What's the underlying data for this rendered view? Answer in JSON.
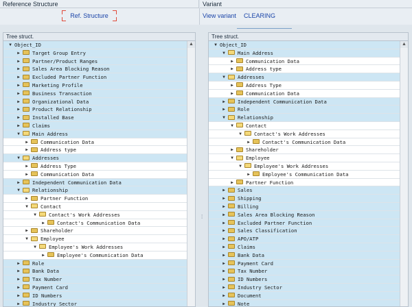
{
  "left_panel": {
    "title": "Reference Structure",
    "ref_button": "Ref. Structure",
    "tree_header": "Tree struct.",
    "rows": [
      {
        "label": "Object_ID",
        "depth": 0,
        "toggle": "open",
        "folder": false,
        "selected": true
      },
      {
        "label": "Target Group Entry",
        "depth": 1,
        "toggle": "closed",
        "folder": true,
        "selected": true
      },
      {
        "label": "Partner/Product Ranges",
        "depth": 1,
        "toggle": "closed",
        "folder": true,
        "selected": true
      },
      {
        "label": "Sales Area Blocking Reason",
        "depth": 1,
        "toggle": "closed",
        "folder": true,
        "selected": true
      },
      {
        "label": "Excluded Partner Function",
        "depth": 1,
        "toggle": "closed",
        "folder": true,
        "selected": true
      },
      {
        "label": "Marketing Profile",
        "depth": 1,
        "toggle": "closed",
        "folder": true,
        "selected": true
      },
      {
        "label": "Business Transaction",
        "depth": 1,
        "toggle": "closed",
        "folder": true,
        "selected": true
      },
      {
        "label": "Organizational Data",
        "depth": 1,
        "toggle": "closed",
        "folder": true,
        "selected": true
      },
      {
        "label": "Product Relationship",
        "depth": 1,
        "toggle": "closed",
        "folder": true,
        "selected": true
      },
      {
        "label": "Installed Base",
        "depth": 1,
        "toggle": "closed",
        "folder": true,
        "selected": true
      },
      {
        "label": "Claims",
        "depth": 1,
        "toggle": "closed",
        "folder": true,
        "selected": true
      },
      {
        "label": "Main Address",
        "depth": 1,
        "toggle": "open",
        "folder": true,
        "selected": true
      },
      {
        "label": "Communication Data",
        "depth": 2,
        "toggle": "closed",
        "folder": true,
        "selected": false
      },
      {
        "label": "Address type",
        "depth": 2,
        "toggle": "closed",
        "folder": true,
        "selected": false
      },
      {
        "label": "Addresses",
        "depth": 1,
        "toggle": "open",
        "folder": true,
        "selected": true
      },
      {
        "label": "Address Type",
        "depth": 2,
        "toggle": "closed",
        "folder": true,
        "selected": false
      },
      {
        "label": "Communication Data",
        "depth": 2,
        "toggle": "closed",
        "folder": true,
        "selected": false
      },
      {
        "label": "Independent Communication Data",
        "depth": 1,
        "toggle": "closed",
        "folder": true,
        "selected": true
      },
      {
        "label": "Relationship",
        "depth": 1,
        "toggle": "open",
        "folder": true,
        "selected": true
      },
      {
        "label": "Partner Function",
        "depth": 2,
        "toggle": "closed",
        "folder": true,
        "selected": false
      },
      {
        "label": "Contact",
        "depth": 2,
        "toggle": "open",
        "folder": true,
        "selected": false
      },
      {
        "label": "Contact's Work Addresses",
        "depth": 3,
        "toggle": "open",
        "folder": true,
        "selected": false
      },
      {
        "label": "Contact's Communication Data",
        "depth": 4,
        "toggle": "closed",
        "folder": true,
        "selected": false
      },
      {
        "label": "Shareholder",
        "depth": 2,
        "toggle": "closed",
        "folder": true,
        "selected": false
      },
      {
        "label": "Employee",
        "depth": 2,
        "toggle": "open",
        "folder": true,
        "selected": false
      },
      {
        "label": "Employee's Work Addresses",
        "depth": 3,
        "toggle": "open",
        "folder": true,
        "selected": false
      },
      {
        "label": "Employee's Communication Data",
        "depth": 4,
        "toggle": "closed",
        "folder": true,
        "selected": false
      },
      {
        "label": "Role",
        "depth": 1,
        "toggle": "closed",
        "folder": true,
        "selected": true
      },
      {
        "label": "Bank Data",
        "depth": 1,
        "toggle": "closed",
        "folder": true,
        "selected": true
      },
      {
        "label": "Tax Number",
        "depth": 1,
        "toggle": "closed",
        "folder": true,
        "selected": true
      },
      {
        "label": "Payment Card",
        "depth": 1,
        "toggle": "closed",
        "folder": true,
        "selected": true
      },
      {
        "label": "ID Numbers",
        "depth": 1,
        "toggle": "closed",
        "folder": true,
        "selected": true
      },
      {
        "label": "Industry Sector",
        "depth": 1,
        "toggle": "closed",
        "folder": true,
        "selected": true
      }
    ]
  },
  "right_panel": {
    "title": "Variant",
    "view_variant": "View variant",
    "clearing": "CLEARING",
    "tree_header": "Tree struct.",
    "rows": [
      {
        "label": "Object_ID",
        "depth": 0,
        "toggle": "open",
        "folder": false,
        "selected": true
      },
      {
        "label": "Main Address",
        "depth": 1,
        "toggle": "open",
        "folder": true,
        "selected": true
      },
      {
        "label": "Communication Data",
        "depth": 2,
        "toggle": "closed",
        "folder": true,
        "selected": false
      },
      {
        "label": "Address type",
        "depth": 2,
        "toggle": "closed",
        "folder": true,
        "selected": false
      },
      {
        "label": "Addresses",
        "depth": 1,
        "toggle": "open",
        "folder": true,
        "selected": true
      },
      {
        "label": "Address Type",
        "depth": 2,
        "toggle": "closed",
        "folder": true,
        "selected": false
      },
      {
        "label": "Communication Data",
        "depth": 2,
        "toggle": "closed",
        "folder": true,
        "selected": false
      },
      {
        "label": "Independent Communication Data",
        "depth": 1,
        "toggle": "closed",
        "folder": true,
        "selected": true
      },
      {
        "label": "Role",
        "depth": 1,
        "toggle": "closed",
        "folder": true,
        "selected": true
      },
      {
        "label": "Relationship",
        "depth": 1,
        "toggle": "open",
        "folder": true,
        "selected": true
      },
      {
        "label": "Contact",
        "depth": 2,
        "toggle": "open",
        "folder": true,
        "selected": false
      },
      {
        "label": "Contact's Work Addresses",
        "depth": 3,
        "toggle": "open",
        "folder": true,
        "selected": false
      },
      {
        "label": "Contact's Communication Data",
        "depth": 4,
        "toggle": "closed",
        "folder": true,
        "selected": false
      },
      {
        "label": "Shareholder",
        "depth": 2,
        "toggle": "closed",
        "folder": true,
        "selected": false
      },
      {
        "label": "Employee",
        "depth": 2,
        "toggle": "open",
        "folder": true,
        "selected": false
      },
      {
        "label": "Employee's Work Addresses",
        "depth": 3,
        "toggle": "open",
        "folder": true,
        "selected": false
      },
      {
        "label": "Employee's Communication Data",
        "depth": 4,
        "toggle": "closed",
        "folder": true,
        "selected": false
      },
      {
        "label": "Partner Function",
        "depth": 2,
        "toggle": "closed",
        "folder": true,
        "selected": false
      },
      {
        "label": "Sales",
        "depth": 1,
        "toggle": "closed",
        "folder": true,
        "selected": true
      },
      {
        "label": "Shipping",
        "depth": 1,
        "toggle": "closed",
        "folder": true,
        "selected": true
      },
      {
        "label": "Billing",
        "depth": 1,
        "toggle": "closed",
        "folder": true,
        "selected": true
      },
      {
        "label": "Sales Area Blocking Reason",
        "depth": 1,
        "toggle": "closed",
        "folder": true,
        "selected": true
      },
      {
        "label": "Excluded Partner Function",
        "depth": 1,
        "toggle": "closed",
        "folder": true,
        "selected": true
      },
      {
        "label": "Sales Classification",
        "depth": 1,
        "toggle": "closed",
        "folder": true,
        "selected": true
      },
      {
        "label": "APO/ATP",
        "depth": 1,
        "toggle": "closed",
        "folder": true,
        "selected": true
      },
      {
        "label": "Claims",
        "depth": 1,
        "toggle": "closed",
        "folder": true,
        "selected": true
      },
      {
        "label": "Bank Data",
        "depth": 1,
        "toggle": "closed",
        "folder": true,
        "selected": true
      },
      {
        "label": "Payment Card",
        "depth": 1,
        "toggle": "closed",
        "folder": true,
        "selected": true
      },
      {
        "label": "Tax Number",
        "depth": 1,
        "toggle": "closed",
        "folder": true,
        "selected": true
      },
      {
        "label": "ID Numbers",
        "depth": 1,
        "toggle": "closed",
        "folder": true,
        "selected": true
      },
      {
        "label": "Industry Sector",
        "depth": 1,
        "toggle": "closed",
        "folder": true,
        "selected": true
      },
      {
        "label": "Document",
        "depth": 1,
        "toggle": "closed",
        "folder": true,
        "selected": true
      },
      {
        "label": "Note",
        "depth": 1,
        "toggle": "closed",
        "folder": true,
        "selected": true
      }
    ]
  },
  "colors": {
    "selected_row": "#cde6f4",
    "folder": "#e6c35a",
    "link": "#1a44a8"
  }
}
